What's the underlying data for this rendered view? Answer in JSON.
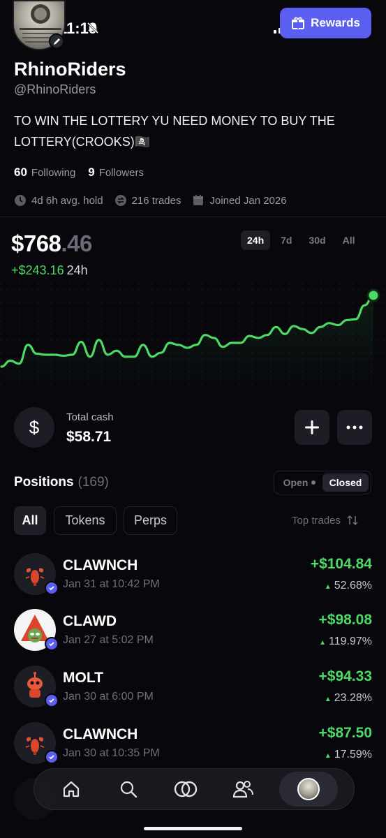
{
  "status": {
    "time": "11:19",
    "battery_icon": "battery-charging-icon"
  },
  "rewards": {
    "label": "Rewards"
  },
  "profile": {
    "name": "RhinoRiders",
    "handle": "@RhinoRiders",
    "bio": "TO WIN THE LOTTERY YU NEED MONEY TO BUY THE LOTTERY(CROOKS)🏴‍☠️",
    "following_count": "60",
    "following_label": "Following",
    "followers_count": "9",
    "followers_label": "Followers",
    "avg_hold": "4d 6h avg. hold",
    "trades": "216 trades",
    "joined": "Joined Jan 2026"
  },
  "portfolio": {
    "balance_main": "$768",
    "balance_cents": ".46",
    "change_value": "+$243.16",
    "change_period": "24h",
    "ranges": [
      "24h",
      "7d",
      "30d",
      "All"
    ],
    "active_range": "24h",
    "accent": "#4cd964"
  },
  "chart_data": {
    "type": "line",
    "series": [
      {
        "values": [
          0,
          6,
          3,
          22,
          13,
          12,
          12,
          11,
          12,
          25,
          10,
          27,
          12,
          16,
          10,
          10,
          22,
          10,
          14,
          24,
          22,
          19,
          22,
          32,
          29,
          20,
          24,
          24,
          31,
          29,
          32,
          40,
          33,
          41,
          38,
          34,
          40,
          44,
          42,
          47,
          48,
          62,
          72
        ]
      }
    ],
    "grid": false,
    "legend": "none"
  },
  "cash": {
    "label": "Total cash",
    "value": "$58.71"
  },
  "positions": {
    "title": "Positions",
    "count": "(169)",
    "open_label": "Open",
    "closed_label": "Closed",
    "filters": [
      "All",
      "Tokens",
      "Perps"
    ],
    "sort_label": "Top trades",
    "items": [
      {
        "name": "CLAWNCH",
        "date": "Jan 31 at 10:42 PM",
        "pnl": "+$104.84",
        "pct": "52.68%",
        "icon": "lobster-icon"
      },
      {
        "name": "CLAWD",
        "date": "Jan 27 at 5:02 PM",
        "pnl": "+$98.08",
        "pct": "119.97%",
        "icon": "pepe-icon"
      },
      {
        "name": "MOLT",
        "date": "Jan 30 at 6:00 PM",
        "pnl": "+$94.33",
        "pct": "23.28%",
        "icon": "robot-icon"
      },
      {
        "name": "CLAWNCH",
        "date": "Jan 30 at 10:35 PM",
        "pnl": "+$87.50",
        "pct": "17.59%",
        "icon": "lobster-icon"
      }
    ]
  },
  "nav": {
    "items": [
      "home-icon",
      "search-icon",
      "swap-icon",
      "people-icon",
      "profile-avatar"
    ]
  }
}
